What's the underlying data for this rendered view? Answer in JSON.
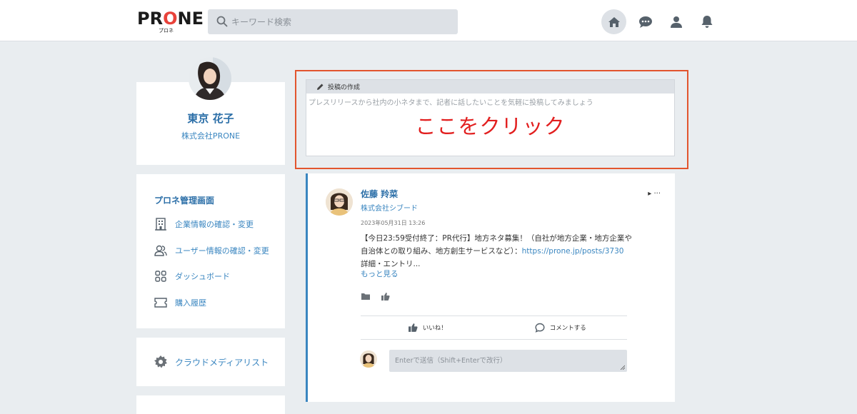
{
  "header": {
    "logo_text_pre": "PR",
    "logo_text_o": "O",
    "logo_text_post": "NE",
    "logo_sub": "プロネ",
    "search_placeholder": "キーワード検索",
    "icons": [
      "home-icon",
      "chat-icon",
      "user-icon",
      "bell-icon"
    ]
  },
  "profile": {
    "name": "東京 花子",
    "company": "株式会社PRONE"
  },
  "menu": {
    "title": "プロネ管理画面",
    "items": [
      {
        "label": "企業情報の確認・変更",
        "icon": "building-icon"
      },
      {
        "label": "ユーザー情報の確認・変更",
        "icon": "users-icon"
      },
      {
        "label": "ダッシュボード",
        "icon": "dashboard-icon"
      },
      {
        "label": "購入履歴",
        "icon": "ticket-icon"
      }
    ]
  },
  "cloud": {
    "label": "クラウドメディアリスト"
  },
  "compose": {
    "header_label": "投稿の作成",
    "placeholder": "プレスリリースから社内の小ネタまで、記者に話したいことを気軽に投稿してみましょう",
    "callout": "ここをクリック",
    "highlight_color": "#e2552e",
    "callout_color": "#e21f1f"
  },
  "post": {
    "author": "佐藤 羚菜",
    "company": "株式会社シブード",
    "more": "▸ ···",
    "date": "2023年05月31日 13:26",
    "body_line1": "【今日23:59受付終了：PR代行】地方ネタ募集！（自社が地方企業・地方企業や",
    "body_line2": "自治体との取り組み、地方創生サービスなど）：",
    "body_link": "https://prone.jp/posts/3730",
    "body_line3": "詳細・エントリ...",
    "read_more": "もっと見る",
    "like_label": "いいね！",
    "comment_label": "コメントする",
    "comment_placeholder": "Enterで送信（Shift+Enterで改行）"
  },
  "colors": {
    "accent": "#3a86c0",
    "accent_dark": "#2c6fa8",
    "background": "#e9edf0"
  }
}
